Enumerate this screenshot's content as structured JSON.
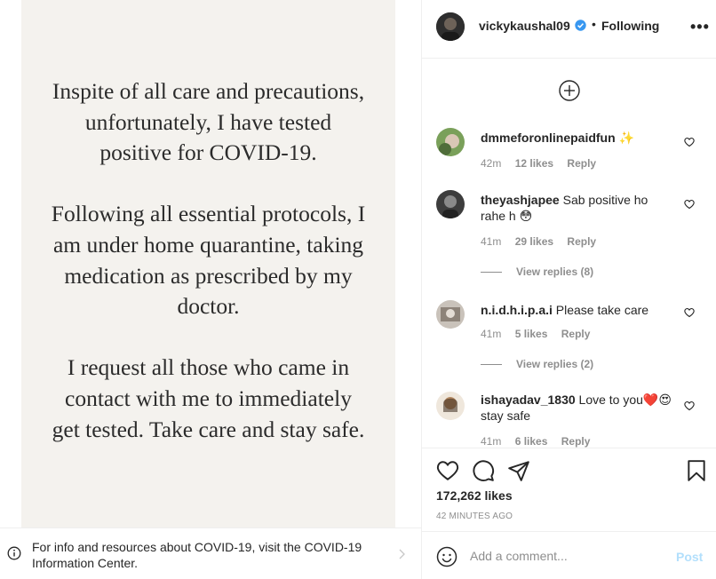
{
  "media": {
    "paragraphs": [
      "Inspite of all care and precautions,\nunfortunately, I have tested\npositive for COVID-19.",
      "Following all essential protocols, I\nam under home quarantine, taking\nmedication as prescribed by my\ndoctor.",
      "I request all those who came in\ncontact with me to immediately\nget tested. Take care and stay safe."
    ]
  },
  "info_bar": {
    "text": "For info and resources about COVID-19, visit the COVID-19 Information Center.",
    "icon": "info-icon"
  },
  "header": {
    "username": "vickykaushal09",
    "separator": "•",
    "following_label": "Following",
    "more_label": "•••"
  },
  "comments": [
    {
      "username": "dmmeforonlinepaidfun",
      "text": "✨",
      "time": "42m",
      "likes": "12 likes",
      "reply": "Reply",
      "avatar_color": "#6b8f4e"
    },
    {
      "username": "theyashjapee",
      "text": "Sab positive ho rahe h 😳",
      "time": "41m",
      "likes": "29 likes",
      "reply": "Reply",
      "view_replies": "View replies (8)",
      "avatar_color": "#4a4a4a"
    },
    {
      "username": "n.i.d.h.i.p.a.i",
      "text": "Please take care",
      "time": "41m",
      "likes": "5 likes",
      "reply": "Reply",
      "view_replies": "View replies (2)",
      "avatar_color": "#9a8f88"
    },
    {
      "username": "ishayadav_1830",
      "text": "Love to you❤️😍 stay safe",
      "time": "41m",
      "likes": "6 likes",
      "reply": "Reply",
      "avatar_color": "#8c6a4f"
    }
  ],
  "actions": {
    "likes": "172,262 likes",
    "time_ago": "42 MINUTES AGO"
  },
  "add_comment": {
    "placeholder": "Add a comment...",
    "post_label": "Post"
  },
  "colors": {
    "verified": "#3897f0",
    "post_disabled": "#b2dffc",
    "muted": "#8e8e8e",
    "card_bg": "#f4f2ee"
  }
}
